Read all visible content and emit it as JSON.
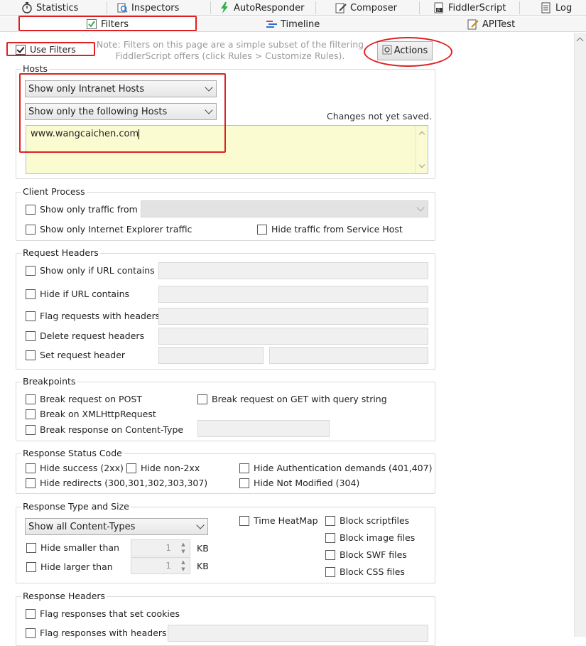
{
  "tabs_row1": [
    {
      "label": "Statistics",
      "icon": "stopwatch-icon"
    },
    {
      "label": "Inspectors",
      "icon": "inspector-icon"
    },
    {
      "label": "AutoResponder",
      "icon": "lightning-icon"
    },
    {
      "label": "Composer",
      "icon": "pencil-icon"
    },
    {
      "label": "FiddlerScript",
      "icon": "script-icon"
    },
    {
      "label": "Log",
      "icon": "log-icon"
    }
  ],
  "tabs_row2": [
    {
      "label": "Filters",
      "icon": "checkbox-icon",
      "selected": true
    },
    {
      "label": "Timeline",
      "icon": "timeline-icon"
    },
    {
      "label": "APITest",
      "icon": "edit-icon"
    }
  ],
  "top": {
    "use_filters_label": "Use Filters",
    "use_filters_checked": true,
    "note_line1": "Note: Filters on this page are a simple subset of the filtering",
    "note_line2": "FiddlerScript offers (click Rules > Customize Rules).",
    "actions_label": "Actions"
  },
  "hosts": {
    "legend": "Hosts",
    "zone_select": "Show only Intranet Hosts",
    "host_select": "Show only the following Hosts",
    "changes_note": "Changes not yet saved.",
    "host_list_value": "www.wangcaichen.com"
  },
  "client_process": {
    "legend": "Client Process",
    "show_only_traffic_from": "Show only traffic from",
    "show_only_ie": "Show only Internet Explorer traffic",
    "hide_service_host": "Hide traffic from Service Host"
  },
  "request_headers": {
    "legend": "Request Headers",
    "show_if_url": "Show only if URL contains",
    "hide_if_url": "Hide if URL contains",
    "flag_with_headers": "Flag requests with headers",
    "delete_headers": "Delete request headers",
    "set_header": "Set request header"
  },
  "breakpoints": {
    "legend": "Breakpoints",
    "break_post": "Break request on POST",
    "break_get_query": "Break request on GET with query string",
    "break_xhr": "Break on XMLHttpRequest",
    "break_content_type": "Break response on Content-Type"
  },
  "status_code": {
    "legend": "Response Status Code",
    "hide_success": "Hide success (2xx)",
    "hide_non_2xx": "Hide non-2xx",
    "hide_auth": "Hide Authentication demands (401,407)",
    "hide_redirects": "Hide redirects (300,301,302,303,307)",
    "hide_not_modified": "Hide Not Modified (304)"
  },
  "type_size": {
    "legend": "Response Type and Size",
    "content_type_select": "Show all Content-Types",
    "time_heatmap": "Time HeatMap",
    "block_script": "Block scriptfiles",
    "block_image": "Block image files",
    "block_swf": "Block SWF files",
    "block_css": "Block CSS files",
    "hide_smaller": "Hide smaller than",
    "hide_larger": "Hide larger than",
    "smaller_value": "1",
    "larger_value": "1",
    "unit": "KB"
  },
  "response_headers": {
    "legend": "Response Headers",
    "flag_cookies": "Flag responses that set cookies",
    "flag_with_headers": "Flag responses with headers"
  },
  "colors": {
    "annotation": "#e02020",
    "host_list_bg": "#fbfbd2"
  }
}
